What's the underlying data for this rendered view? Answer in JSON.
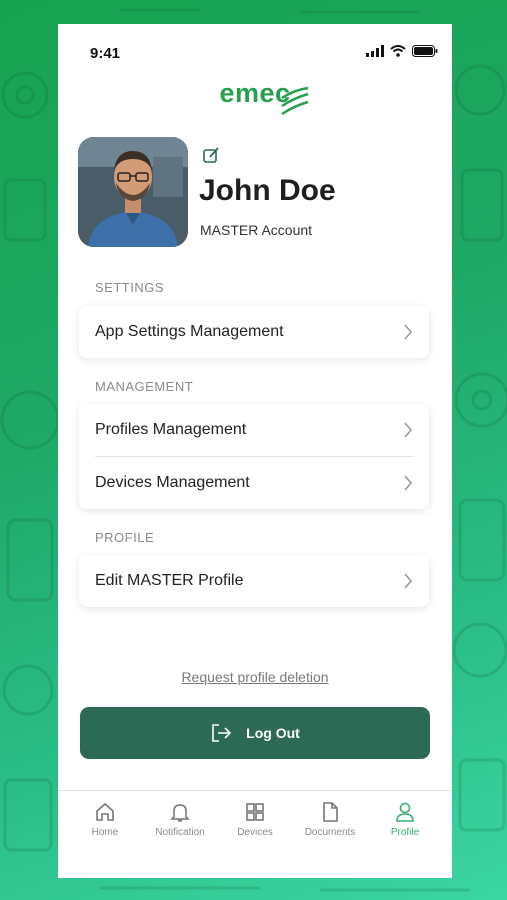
{
  "status": {
    "time": "9:41"
  },
  "brand": {
    "name": "emec",
    "color": "#27a04b"
  },
  "profile": {
    "name": "John Doe",
    "account_type": "MASTER Account",
    "avatar_icon": "user-photo",
    "edit_icon": "edit-icon"
  },
  "sections": {
    "settings": {
      "label": "SETTINGS",
      "items": [
        {
          "label": "App Settings Management"
        }
      ]
    },
    "management": {
      "label": "MANAGEMENT",
      "items": [
        {
          "label": "Profiles Management"
        },
        {
          "label": "Devices Management"
        }
      ]
    },
    "profile": {
      "label": "PROFILE",
      "items": [
        {
          "label": "Edit MASTER Profile"
        }
      ]
    }
  },
  "actions": {
    "delete_link": "Request profile deletion",
    "logout_label": "Log Out",
    "logout_color": "#2d6a55"
  },
  "tabs": [
    {
      "label": "Home",
      "icon": "home-icon"
    },
    {
      "label": "Notification",
      "icon": "bell-icon"
    },
    {
      "label": "Devices",
      "icon": "grid-icon"
    },
    {
      "label": "Documents",
      "icon": "document-icon"
    },
    {
      "label": "Profile",
      "icon": "user-icon",
      "active": true
    }
  ],
  "accent_color": "#37b06b"
}
